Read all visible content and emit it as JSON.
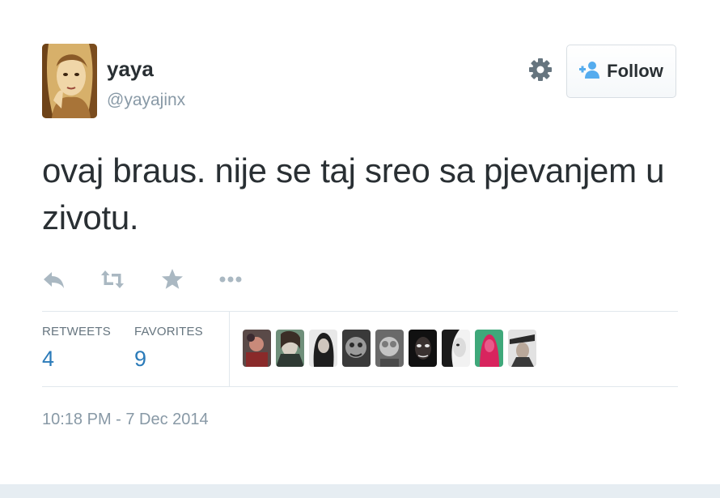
{
  "user": {
    "name": "yaya",
    "handle": "@yayajinx"
  },
  "header": {
    "follow_label": "Follow",
    "settings_icon": "gear-icon",
    "follow_icon": "add-user-icon"
  },
  "tweet": {
    "text": "ovaj braus. nije se taj sreo sa pjevanjem u zivotu."
  },
  "actions": [
    {
      "icon": "reply-icon"
    },
    {
      "icon": "retweet-icon"
    },
    {
      "icon": "star-icon"
    },
    {
      "icon": "more-icon"
    }
  ],
  "stats": {
    "retweets_label": "RETWEETS",
    "retweets_count": "4",
    "favorites_label": "FAVORITES",
    "favorites_count": "9"
  },
  "favoriters": [
    {
      "icon": "avatar"
    },
    {
      "icon": "avatar"
    },
    {
      "icon": "avatar"
    },
    {
      "icon": "avatar"
    },
    {
      "icon": "avatar"
    },
    {
      "icon": "avatar"
    },
    {
      "icon": "avatar"
    },
    {
      "icon": "avatar"
    },
    {
      "icon": "avatar"
    }
  ],
  "timestamp": "10:18 PM - 7 Dec 2014",
  "colors": {
    "link": "#2b7bb9",
    "muted": "#8899a6",
    "text": "#292f33",
    "bottom_bar": "#e6edf2"
  }
}
